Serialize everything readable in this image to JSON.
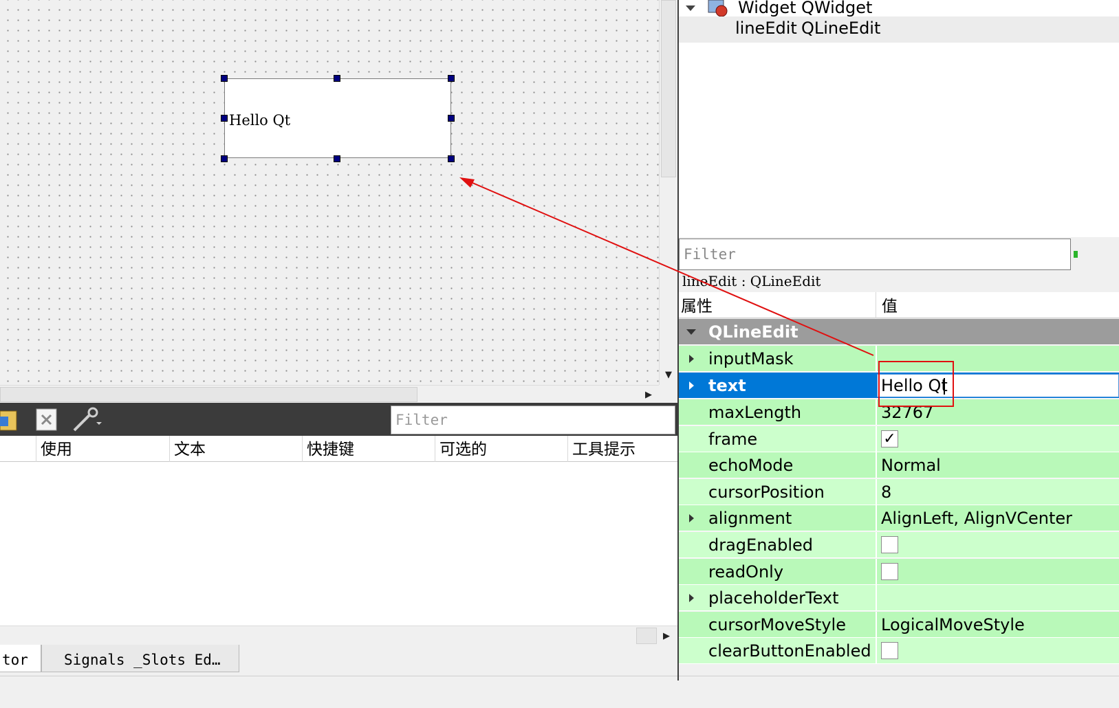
{
  "form": {
    "lineedit_text": "Hello Qt"
  },
  "object_inspector": {
    "rows": [
      {
        "name": "Widget",
        "class": "QWidget"
      },
      {
        "name": "lineEdit",
        "class": "QLineEdit"
      }
    ]
  },
  "property_editor": {
    "filter_placeholder": "Filter",
    "class_label": "lineEdit : QLineEdit",
    "header_property": "属性",
    "header_value": "值",
    "group": "QLineEdit",
    "properties": [
      {
        "name": "inputMask",
        "value": ""
      },
      {
        "name": "text",
        "value": "Hello Qt"
      },
      {
        "name": "maxLength",
        "value": "32767"
      },
      {
        "name": "frame",
        "value": "✓"
      },
      {
        "name": "echoMode",
        "value": "Normal"
      },
      {
        "name": "cursorPosition",
        "value": "8"
      },
      {
        "name": "alignment",
        "value": "AlignLeft, AlignVCenter"
      },
      {
        "name": "dragEnabled",
        "value": ""
      },
      {
        "name": "readOnly",
        "value": ""
      },
      {
        "name": "placeholderText",
        "value": ""
      },
      {
        "name": "cursorMoveStyle",
        "value": "LogicalMoveStyle"
      },
      {
        "name": "clearButtonEnabled",
        "value": ""
      }
    ]
  },
  "action_editor": {
    "filter_placeholder": "Filter",
    "columns": [
      "使用",
      "文本",
      "快捷键",
      "可选的",
      "工具提示"
    ]
  },
  "tabs": [
    "tor",
    "Signals _Slots Ed…"
  ],
  "colors": {
    "selection": "#0078d7",
    "property_row": "#b9f9b9",
    "property_row_alt": "#ccffcc",
    "group_header": "#9c9c9c",
    "annotation": "#e01010"
  }
}
